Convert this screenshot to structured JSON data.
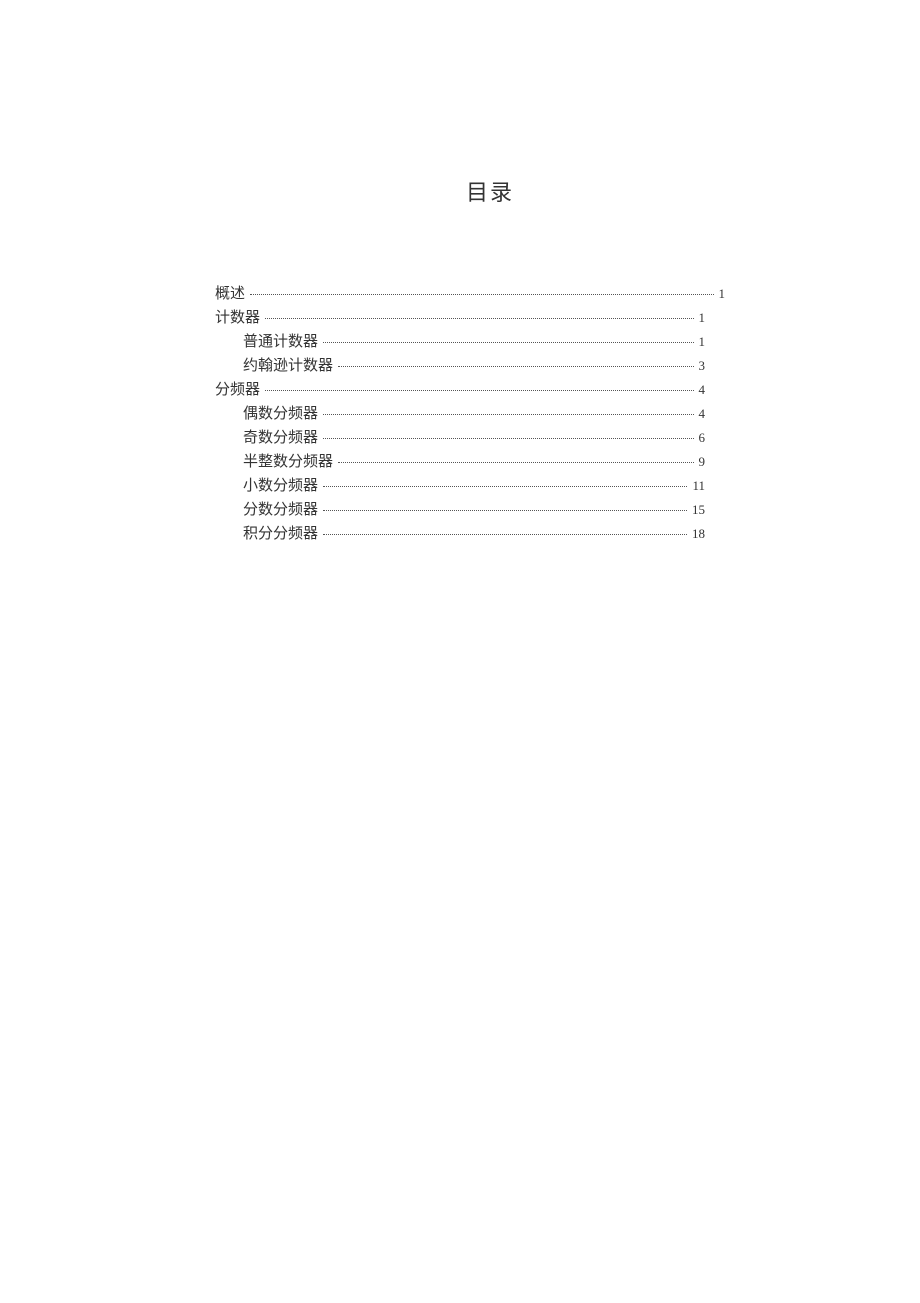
{
  "title": "目录",
  "toc": [
    {
      "label": "概述",
      "page": "1",
      "level": 1,
      "wide": true
    },
    {
      "label": "计数器",
      "page": "1",
      "level": 1,
      "wide": false
    },
    {
      "label": "普通计数器",
      "page": "1",
      "level": 2,
      "wide": false
    },
    {
      "label": "约翰逊计数器",
      "page": "3",
      "level": 2,
      "wide": false
    },
    {
      "label": "分频器",
      "page": "4",
      "level": 1,
      "wide": false
    },
    {
      "label": "偶数分频器",
      "page": "4",
      "level": 2,
      "wide": false
    },
    {
      "label": "奇数分频器",
      "page": "6",
      "level": 2,
      "wide": false
    },
    {
      "label": "半整数分频器",
      "page": "9",
      "level": 2,
      "wide": false
    },
    {
      "label": "小数分频器",
      "page": "11",
      "level": 2,
      "wide": false
    },
    {
      "label": "分数分频器",
      "page": "15",
      "level": 2,
      "wide": false
    },
    {
      "label": "积分分频器",
      "page": "18",
      "level": 2,
      "wide": false
    }
  ]
}
